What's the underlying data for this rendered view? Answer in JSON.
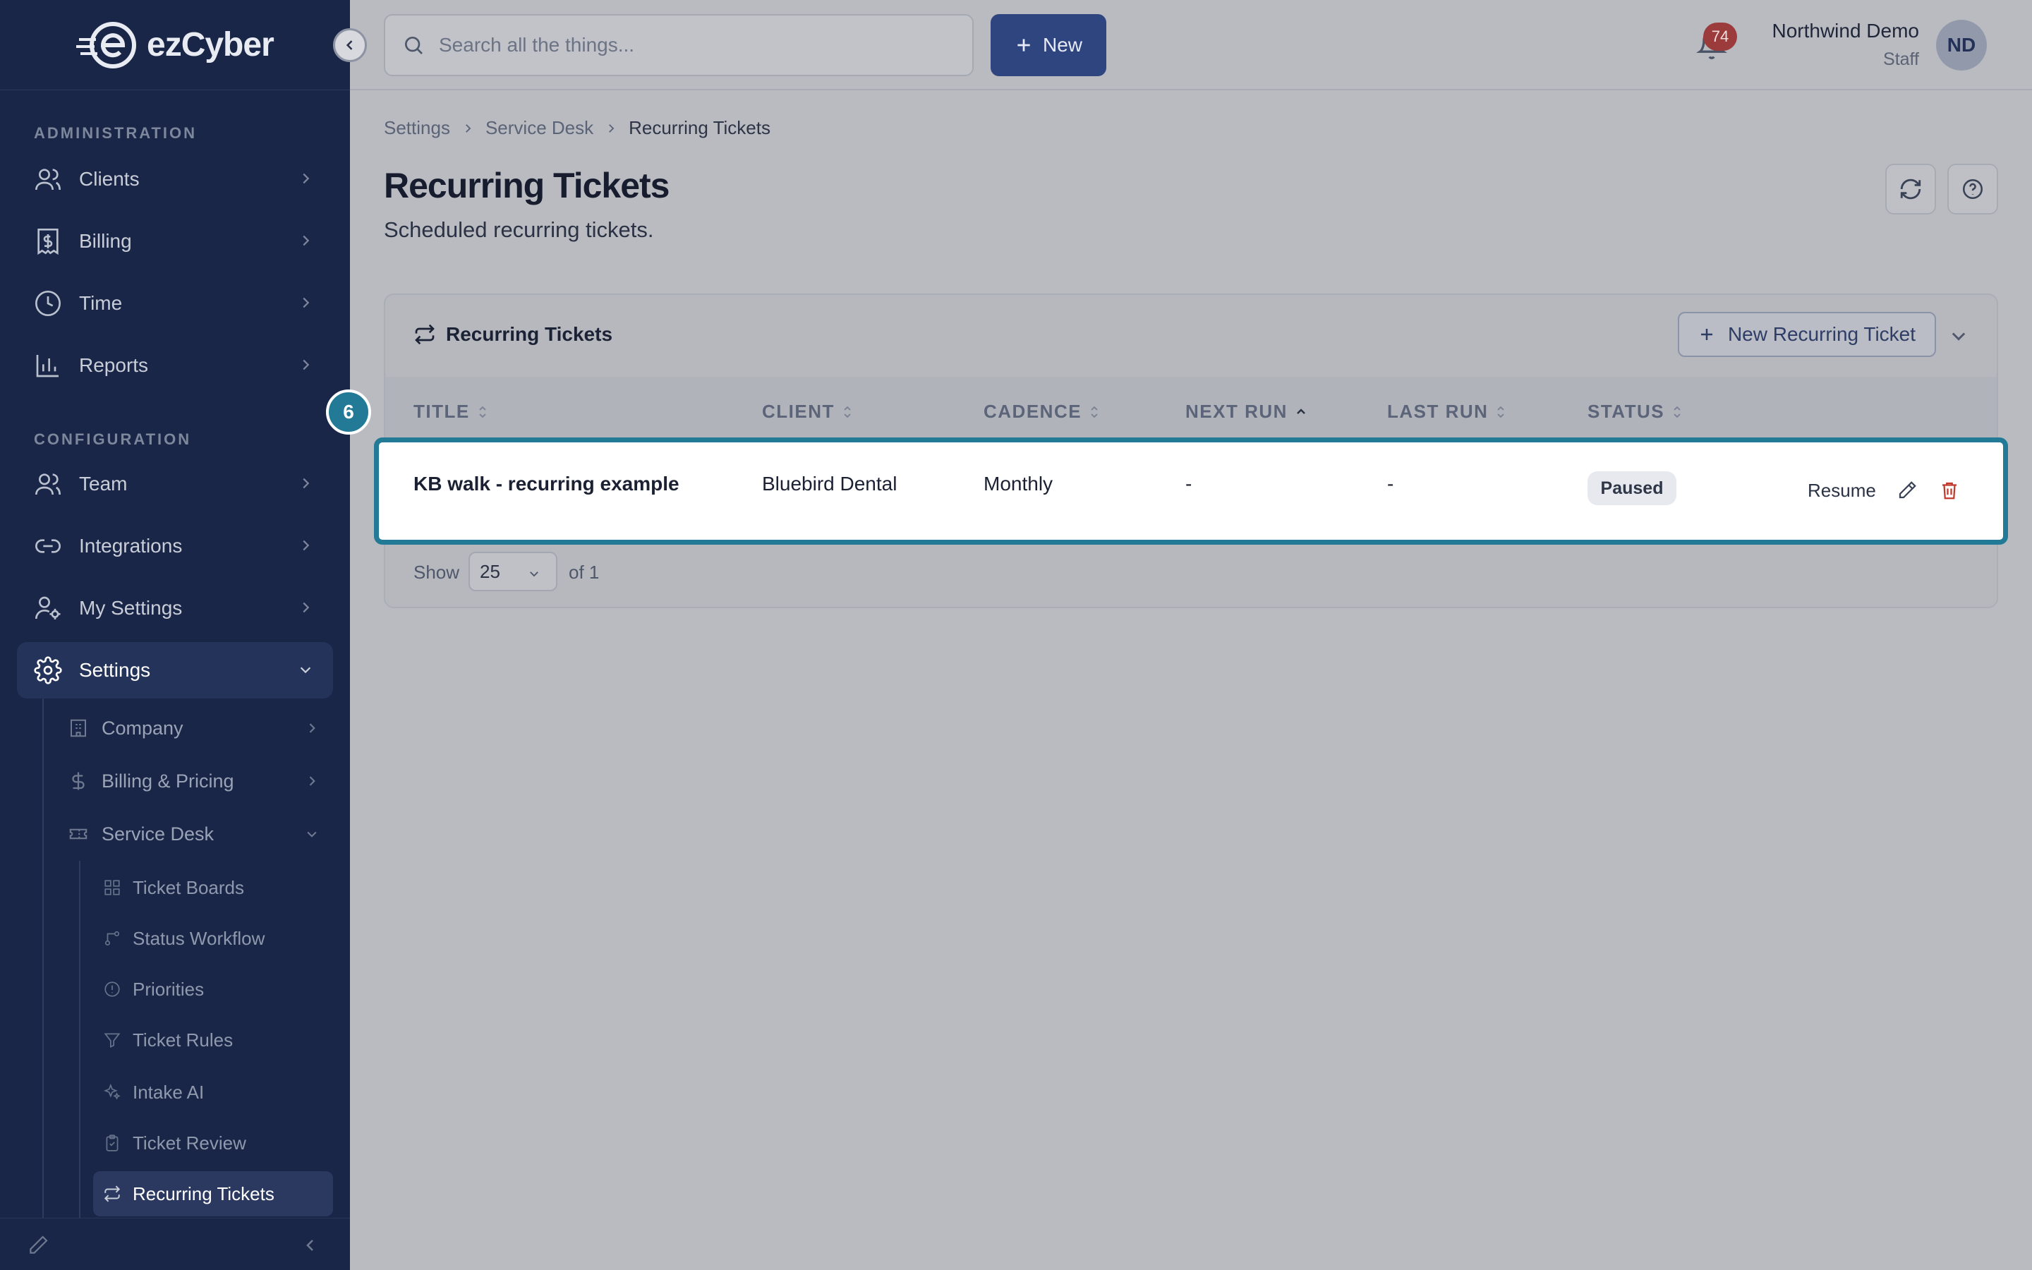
{
  "app": {
    "logo_text": "ezCyber"
  },
  "sidebar": {
    "sections": [
      {
        "label": "ADMINISTRATION"
      },
      {
        "label": "CONFIGURATION"
      }
    ],
    "items": [
      {
        "label": "Clients",
        "icon": "users-icon"
      },
      {
        "label": "Billing",
        "icon": "receipt-icon"
      },
      {
        "label": "Time",
        "icon": "clock-icon"
      },
      {
        "label": "Reports",
        "icon": "bar-chart-icon"
      },
      {
        "label": "Team",
        "icon": "users-icon"
      },
      {
        "label": "Integrations",
        "icon": "link-icon"
      },
      {
        "label": "My Settings",
        "icon": "user-cog-icon"
      },
      {
        "label": "Settings",
        "icon": "gear-icon",
        "active": true
      }
    ],
    "settings_children": [
      {
        "label": "Company",
        "icon": "building-icon"
      },
      {
        "label": "Billing & Pricing",
        "icon": "dollar-icon"
      },
      {
        "label": "Service Desk",
        "icon": "ticket-icon",
        "expanded": true
      }
    ],
    "service_desk_children": [
      {
        "label": "Ticket Boards",
        "icon": "grid-icon"
      },
      {
        "label": "Status Workflow",
        "icon": "workflow-icon"
      },
      {
        "label": "Priorities",
        "icon": "alert-circle-icon"
      },
      {
        "label": "Ticket Rules",
        "icon": "filter-icon"
      },
      {
        "label": "Intake AI",
        "icon": "sparkles-icon"
      },
      {
        "label": "Ticket Review",
        "icon": "clipboard-icon"
      },
      {
        "label": "Recurring Tickets",
        "icon": "repeat-icon",
        "active": true
      }
    ]
  },
  "topbar": {
    "search_placeholder": "Search all the things...",
    "new_label": "New",
    "notification_count": "74",
    "user_name": "Northwind Demo",
    "user_role": "Staff",
    "avatar_initials": "ND"
  },
  "breadcrumb": [
    "Settings",
    "Service Desk",
    "Recurring Tickets"
  ],
  "page": {
    "title": "Recurring Tickets",
    "subtitle": "Scheduled recurring tickets."
  },
  "card": {
    "title": "Recurring Tickets",
    "new_button": "New Recurring Ticket",
    "columns": [
      "TITLE",
      "CLIENT",
      "CADENCE",
      "NEXT RUN",
      "LAST RUN",
      "STATUS"
    ],
    "rows": [
      {
        "title": "KB walk - recurring example",
        "client": "Bluebird Dental",
        "cadence": "Monthly",
        "next_run": "-",
        "last_run": "-",
        "status": "Paused",
        "action": "Resume"
      }
    ],
    "pagination": {
      "show_label": "Show",
      "page_size": "25",
      "of_label": "of 1"
    }
  },
  "tour": {
    "step": "6"
  },
  "colors": {
    "sidebar_bg": "#1a2647",
    "primary": "#2e4580",
    "highlight": "#237a96",
    "danger": "#9b3b3b"
  }
}
